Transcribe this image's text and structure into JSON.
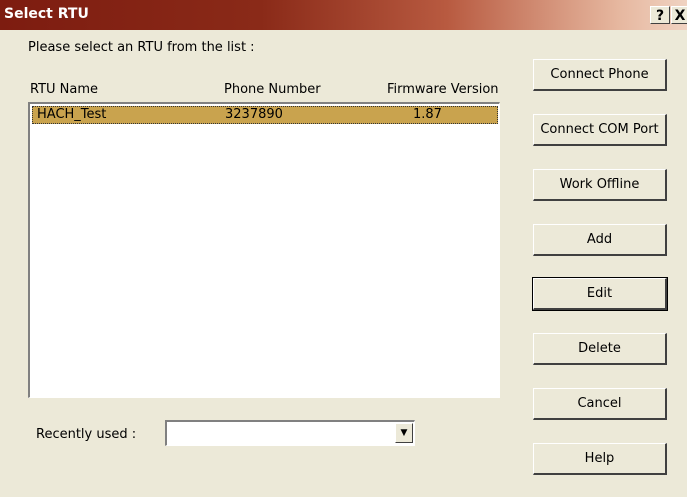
{
  "window": {
    "title": "Select RTU",
    "help_label": "?",
    "close_label": "X"
  },
  "prompt": "Please select an RTU from the list :",
  "columns": {
    "name": "RTU Name",
    "phone": "Phone Number",
    "firmware": "Firmware Version"
  },
  "rows": [
    {
      "name": "HACH_Test",
      "phone": "3237890",
      "firmware": "1.87"
    }
  ],
  "recent": {
    "label": "Recently used :",
    "value": ""
  },
  "buttons": {
    "connect_phone": "Connect Phone",
    "connect_com": "Connect COM Port",
    "work_offline": "Work Offline",
    "add": "Add",
    "edit": "Edit",
    "delete": "Delete",
    "cancel": "Cancel",
    "help": "Help"
  },
  "colors": {
    "selected_row": "#c9a34e",
    "dialog_bg": "#ece9d8"
  }
}
